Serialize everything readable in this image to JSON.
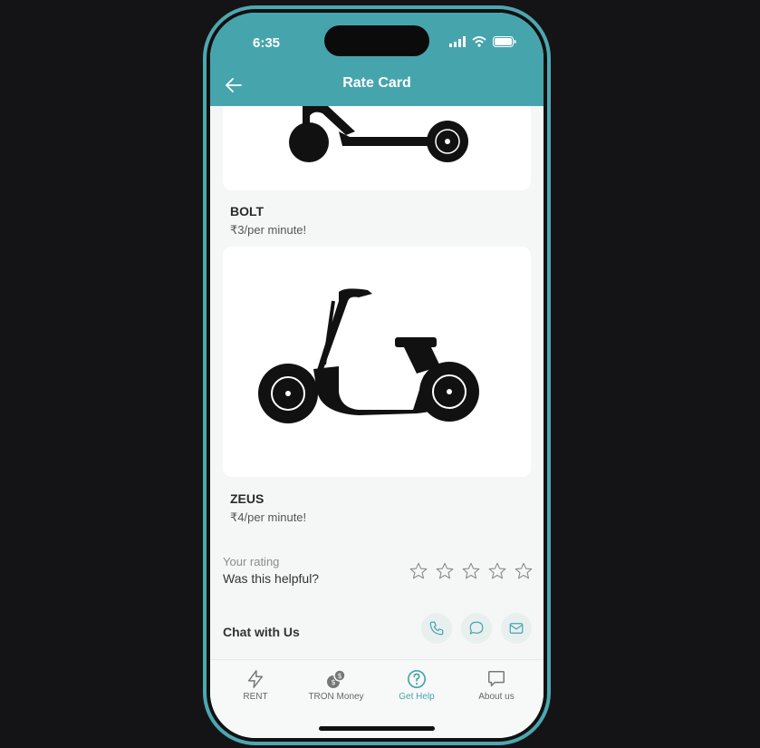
{
  "status": {
    "time": "6:35"
  },
  "header": {
    "title": "Rate Card",
    "back_icon": "arrow-left-icon"
  },
  "vehicles": [
    {
      "name": "BOLT",
      "price": "₹3/per minute!",
      "image": "kick-scooter-silhouette"
    },
    {
      "name": "ZEUS",
      "price": "₹4/per minute!",
      "image": "electric-scooter-silhouette"
    }
  ],
  "rating": {
    "label": "Your rating",
    "question": "Was this helpful?",
    "max_stars": 5,
    "value": 0
  },
  "chat": {
    "label": "Chat with Us",
    "buttons": [
      "phone-icon",
      "chat-bubble-icon",
      "mail-icon"
    ]
  },
  "tabs": [
    {
      "label": "RENT",
      "icon": "lightning-icon"
    },
    {
      "label": "TRON Money",
      "icon": "coins-icon"
    },
    {
      "label": "Get Help",
      "icon": "help-icon",
      "active": true
    },
    {
      "label": "About us",
      "icon": "speech-bubble-icon"
    }
  ],
  "colors": {
    "accent": "#46a5ac",
    "frame": "#4da7b0",
    "background": "#141416"
  }
}
